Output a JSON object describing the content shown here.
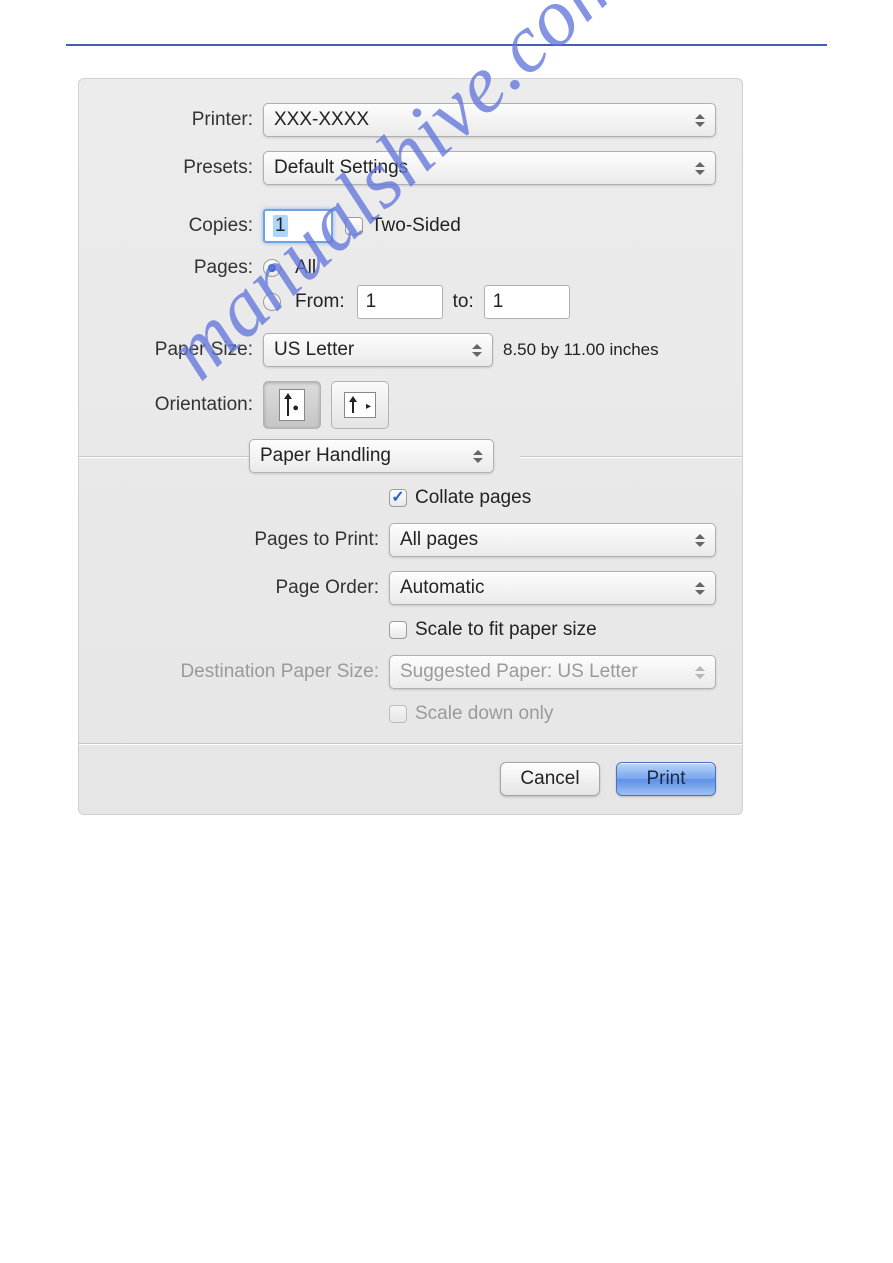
{
  "labels": {
    "printer": "Printer:",
    "presets": "Presets:",
    "copies": "Copies:",
    "two_sided": "Two-Sided",
    "pages": "Pages:",
    "all": "All",
    "from": "From:",
    "to": "to:",
    "paper_size": "Paper Size:",
    "orientation": "Orientation:",
    "collate": "Collate pages",
    "pages_to_print": "Pages to Print:",
    "page_order": "Page Order:",
    "scale_fit": "Scale to fit paper size",
    "dest_paper": "Destination Paper Size:",
    "scale_down": "Scale down only"
  },
  "values": {
    "printer": "XXX-XXXX",
    "presets": "Default Settings",
    "copies": "1",
    "from": "1",
    "to": "1",
    "paper_size": "US Letter",
    "paper_hint": "8.50 by 11.00 inches",
    "section": "Paper Handling",
    "pages_to_print": "All pages",
    "page_order": "Automatic",
    "dest_paper": "Suggested Paper: US Letter"
  },
  "buttons": {
    "cancel": "Cancel",
    "print": "Print"
  },
  "watermark": "manualshive.com"
}
